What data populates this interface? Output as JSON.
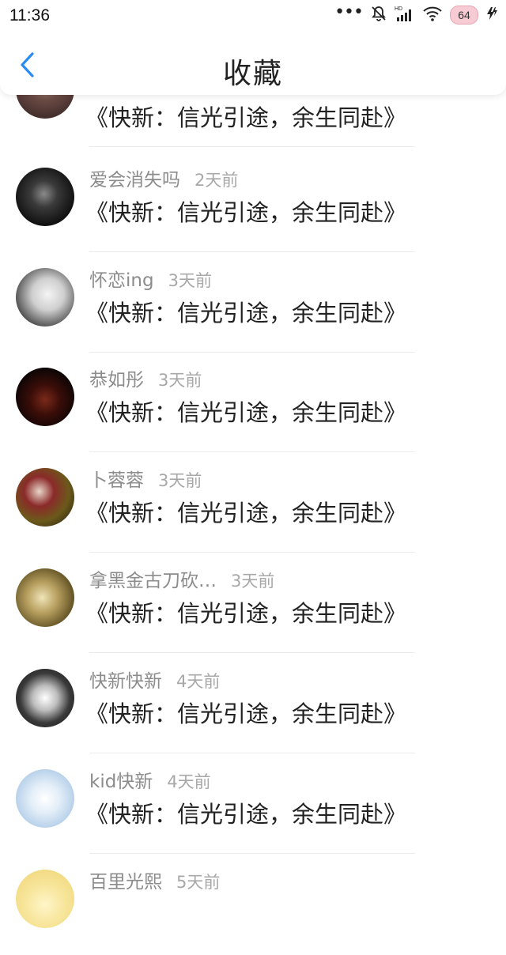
{
  "status_bar": {
    "time": "11:36",
    "dots": "•••",
    "battery": "64"
  },
  "header": {
    "title": "收藏",
    "back_icon": "chevron-left-icon"
  },
  "colors": {
    "accent": "#2a8bf2",
    "name_gray": "#8c8c8c",
    "time_gray": "#a8a8a8"
  },
  "favorites": [
    {
      "user": "",
      "time": "",
      "title": "《快新：信光引途，余生同赴》"
    },
    {
      "user": "爱会消失吗",
      "time": "2天前",
      "title": "《快新：信光引途，余生同赴》"
    },
    {
      "user": "怀恋ing",
      "time": "3天前",
      "title": "《快新：信光引途，余生同赴》"
    },
    {
      "user": "恭如彤",
      "time": "3天前",
      "title": "《快新：信光引途，余生同赴》"
    },
    {
      "user": "卜蓉蓉",
      "time": "3天前",
      "title": "《快新：信光引途，余生同赴》"
    },
    {
      "user": "拿黑金古刀砍…",
      "time": "3天前",
      "title": "《快新：信光引途，余生同赴》"
    },
    {
      "user": "快新快新",
      "time": "4天前",
      "title": "《快新：信光引途，余生同赴》"
    },
    {
      "user": "kid快新",
      "time": "4天前",
      "title": "《快新：信光引途，余生同赴》"
    },
    {
      "user": "百里光熙",
      "time": "5天前",
      "title": ""
    }
  ]
}
